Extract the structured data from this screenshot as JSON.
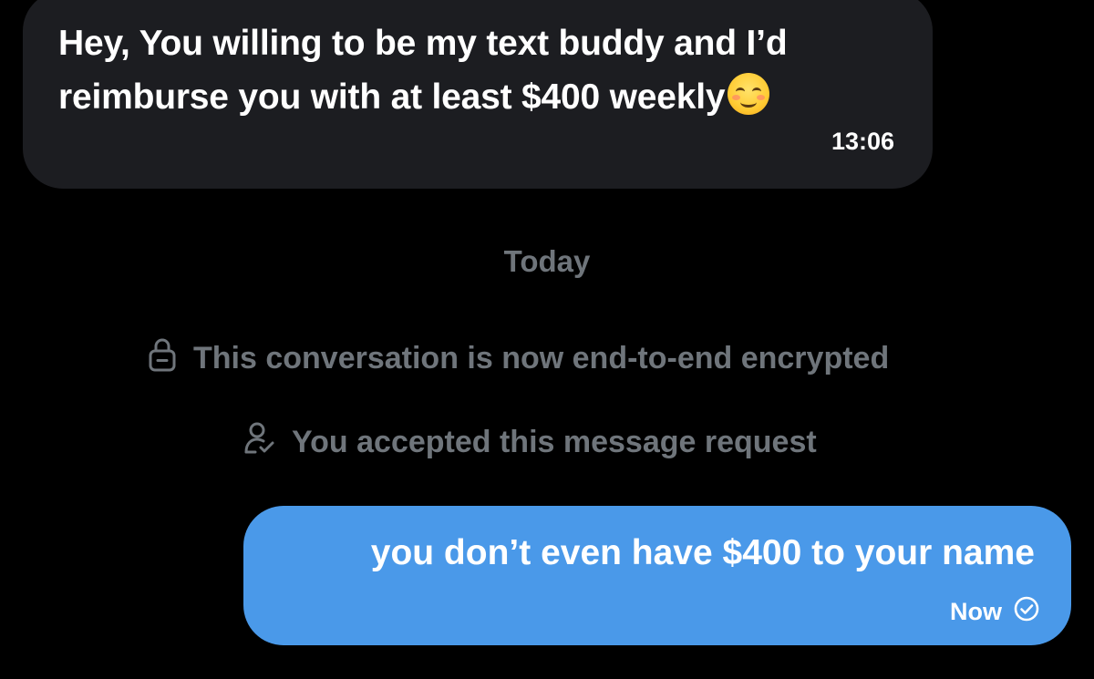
{
  "conversation": {
    "incoming": {
      "text": "Hey, You willing to be my text buddy and I’d reimburse you with at least $400 weekly",
      "emoji": "smiling-face-emoji",
      "time": "13:06"
    },
    "divider_label": "Today",
    "system_notices": [
      {
        "icon": "lock-icon",
        "text": "This conversation is now end-to-end encrypted"
      },
      {
        "icon": "user-check-icon",
        "text": "You accepted this message request"
      }
    ],
    "outgoing": {
      "text": "you don’t even have $400 to your name",
      "time": "Now",
      "status_icon": "sent-check-icon"
    }
  },
  "colors": {
    "background": "#000000",
    "incoming_bubble": "#1c1d21",
    "outgoing_bubble": "#4a99e9",
    "system_text": "#6f757b"
  }
}
